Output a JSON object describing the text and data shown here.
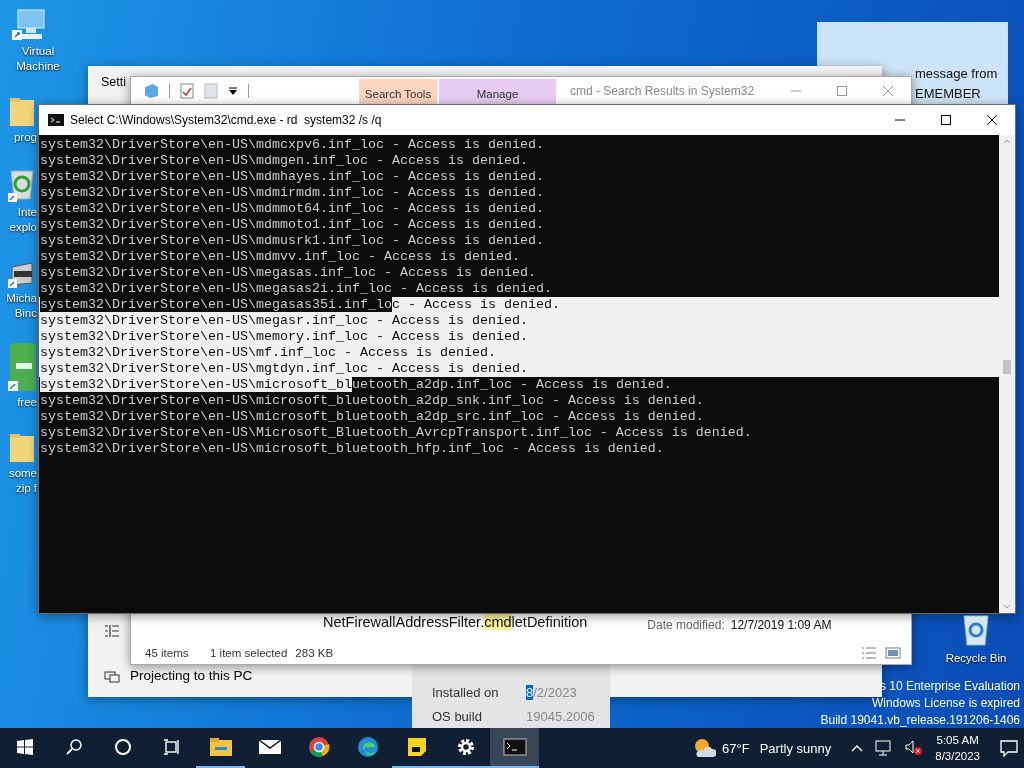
{
  "desktop_icons": [
    {
      "kind": "monitor",
      "label": [
        "Virtual",
        "Machine"
      ]
    },
    {
      "kind": "folder",
      "label": [
        "prog"
      ]
    },
    {
      "kind": "recycle",
      "label": [
        "Inte",
        "explo"
      ]
    },
    {
      "kind": "scanner",
      "label": [
        "Micha",
        "Binc"
      ]
    },
    {
      "kind": "green-app",
      "label": [
        "free"
      ]
    },
    {
      "kind": "folder",
      "label": [
        "some",
        "zip f"
      ]
    }
  ],
  "settings_window": {
    "title": "Setti",
    "nav_item": "Projecting to this PC"
  },
  "about_panel": {
    "rows": [
      {
        "label": "Installed on",
        "value": [
          {
            "text": "8",
            "selected": true
          },
          {
            "text": "/2/2023",
            "selected": false
          }
        ]
      },
      {
        "label": "OS build",
        "value": [
          {
            "text": "19045.2006",
            "selected": false
          }
        ]
      }
    ]
  },
  "notification": {
    "lines": [
      "message from",
      "EMEMBER"
    ]
  },
  "explorer_window": {
    "tabs": [
      {
        "label": "Search Tools",
        "kind": "search"
      },
      {
        "label": "Manage",
        "kind": "manage"
      }
    ],
    "title": "cmd - Search Results in System32",
    "file": {
      "name": [
        {
          "text": "NetFirewallAddressFilter.",
          "highlight": false
        },
        {
          "text": "cmd",
          "highlight": true
        },
        {
          "text": "letDefinition",
          "highlight": false
        }
      ],
      "date_label": "Date modified:",
      "date": "12/7/2019 1:09 AM"
    },
    "status": {
      "count": "45 items",
      "selection": "1 item selected",
      "size": "283 KB"
    }
  },
  "cmd_window": {
    "title": "Select C:\\Windows\\System32\\cmd.exe - rd  system32 /s /q",
    "lines": [
      {
        "parts": [
          {
            "text": "system32\\DriverStore\\en-US\\mdmcxpv6.inf_loc - Access is denied.",
            "selected": false
          }
        ]
      },
      {
        "parts": [
          {
            "text": "system32\\DriverStore\\en-US\\mdmgen.inf_loc - Access is denied.",
            "selected": false
          }
        ]
      },
      {
        "parts": [
          {
            "text": "system32\\DriverStore\\en-US\\mdmhayes.inf_loc - Access is denied.",
            "selected": false
          }
        ]
      },
      {
        "parts": [
          {
            "text": "system32\\DriverStore\\en-US\\mdmirmdm.inf_loc - Access is denied.",
            "selected": false
          }
        ]
      },
      {
        "parts": [
          {
            "text": "system32\\DriverStore\\en-US\\mdmmot64.inf_loc - Access is denied.",
            "selected": false
          }
        ]
      },
      {
        "parts": [
          {
            "text": "system32\\DriverStore\\en-US\\mdmmoto1.inf_loc - Access is denied.",
            "selected": false
          }
        ]
      },
      {
        "parts": [
          {
            "text": "system32\\DriverStore\\en-US\\mdmusrk1.inf_loc - Access is denied.",
            "selected": false
          }
        ]
      },
      {
        "parts": [
          {
            "text": "system32\\DriverStore\\en-US\\mdmvv.inf_loc - Access is denied.",
            "selected": false
          }
        ]
      },
      {
        "parts": [
          {
            "text": "system32\\DriverStore\\en-US\\megasas.inf_loc - Access is denied.",
            "selected": false
          }
        ]
      },
      {
        "parts": [
          {
            "text": "system32\\DriverStore\\en-US\\megasas2i.inf_loc - Access is denied.",
            "selected": false
          }
        ]
      },
      {
        "parts": [
          {
            "text": "system32\\DriverStore\\en-US\\megasas35i.inf_lo",
            "selected": false
          },
          {
            "text": "c - Access is denied.",
            "selected": true
          }
        ]
      },
      {
        "parts": [
          {
            "text": "system32\\DriverStore\\en-US\\megasr.inf_loc - Access is denied.",
            "selected": true
          }
        ]
      },
      {
        "parts": [
          {
            "text": "system32\\DriverStore\\en-US\\memory.inf_loc - Access is denied.",
            "selected": true
          }
        ]
      },
      {
        "parts": [
          {
            "text": "system32\\DriverStore\\en-US\\mf.inf_loc - Access is denied.",
            "selected": true
          }
        ]
      },
      {
        "parts": [
          {
            "text": "system32\\DriverStore\\en-US\\mgtdyn.inf_loc - Access is denied.",
            "selected": true
          }
        ]
      },
      {
        "parts": [
          {
            "text": "system32\\DriverStore\\en-US\\microsoft_bl",
            "selected": true
          },
          {
            "text": "uetooth_a2dp.inf_loc - Access is denied.",
            "selected": false
          }
        ]
      },
      {
        "parts": [
          {
            "text": "system32\\DriverStore\\en-US\\microsoft_bluetooth_a2dp_snk.inf_loc - Access is denied.",
            "selected": false
          }
        ]
      },
      {
        "parts": [
          {
            "text": "system32\\DriverStore\\en-US\\microsoft_bluetooth_a2dp_src.inf_loc - Access is denied.",
            "selected": false
          }
        ]
      },
      {
        "parts": [
          {
            "text": "system32\\DriverStore\\en-US\\Microsoft_Bluetooth_AvrcpTransport.inf_loc - Access is denied.",
            "selected": false
          }
        ]
      },
      {
        "parts": [
          {
            "text": "system32\\DriverStore\\en-US\\microsoft_bluetooth_hfp.inf_loc - Access is denied.",
            "selected": false
          }
        ]
      }
    ]
  },
  "recycle_bin": {
    "label": "Recycle Bin"
  },
  "license_notice": [
    "s 10 Enterprise Evaluation",
    "Windows License is expired",
    "Build 19041.vb_release.191206-1406"
  ],
  "taskbar": {
    "items": [
      {
        "kind": "start",
        "running": false,
        "selected": false
      },
      {
        "kind": "search",
        "running": false,
        "selected": false
      },
      {
        "kind": "cortana",
        "running": false,
        "selected": false
      },
      {
        "kind": "taskview",
        "running": false,
        "selected": false
      },
      {
        "kind": "explorer",
        "running": true,
        "selected": false
      },
      {
        "kind": "mail",
        "running": false,
        "selected": false
      },
      {
        "kind": "chrome",
        "running": false,
        "selected": false
      },
      {
        "kind": "edge",
        "running": false,
        "selected": false
      },
      {
        "kind": "notes",
        "running": true,
        "selected": false
      },
      {
        "kind": "settings",
        "running": true,
        "selected": false
      },
      {
        "kind": "terminal",
        "running": true,
        "selected": true
      }
    ],
    "weather": {
      "temperature": "67°F",
      "condition": "Partly sunny"
    },
    "clock": {
      "time": "5:05 AM",
      "date": "8/3/2023"
    }
  }
}
